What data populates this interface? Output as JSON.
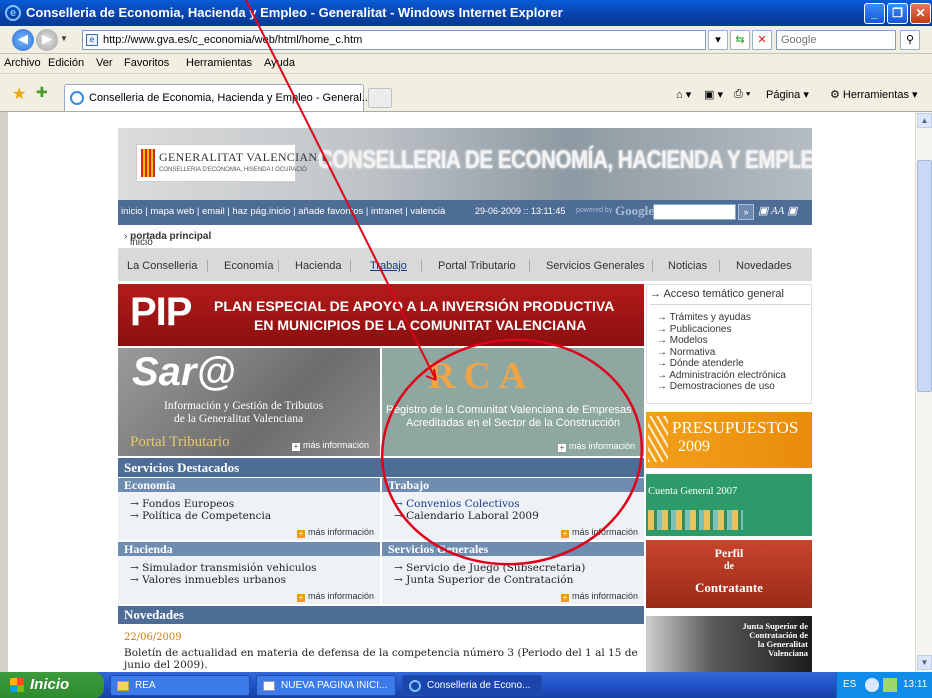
{
  "window": {
    "title": "Conselleria de Economia, Hacienda y Empleo - Generalitat - Windows Internet Explorer",
    "url": "http://www.gva.es/c_economia/web/html/home_c.htm",
    "search_placeholder": "Google"
  },
  "menu": [
    "Archivo",
    "Edición",
    "Ver",
    "Favoritos",
    "Herramientas",
    "Ayuda"
  ],
  "tab": {
    "title": "Conselleria de Economia, Hacienda y Empleo - General..."
  },
  "commands": {
    "pagina": "Página",
    "herramientas": "Herramientas"
  },
  "header": {
    "logo_name": "GENERALITAT VALENCIANA",
    "logo_sub": "CONSELLERIA D'ECONOMIA, HISENDA I OCUPACIÓ",
    "title": "CONSELLERIA DE ECONOMÍA, HACIENDA Y EMPLEO"
  },
  "utility": {
    "links": "inicio | mapa web | email | haz pág.inicio | añade favoritos | intranet | valencià",
    "date": "29-06-2009  ::  13:11:45",
    "powered": "powered by",
    "google": "Google",
    "text_size": "AA"
  },
  "breadcrumb": {
    "home": "inicio",
    "current": "portada principal"
  },
  "nav": [
    "La Conselleria",
    "Economía",
    "Hacienda",
    "Trabajo",
    "Portal Tributario",
    "Servicios Generales",
    "Noticias",
    "Novedades"
  ],
  "pip": {
    "big": "PIP",
    "line1": "PLAN ESPECIAL DE APOYO A LA INVERSIÓN PRODUCTIVA",
    "line2": "EN MUNICIPIOS DE LA COMUNITAT VALENCIANA"
  },
  "sara": {
    "logo": "Sar@",
    "line1": "Información y Gestión de Tributos",
    "line2": "de la Generalitat Valenciana",
    "portal": "Portal Tributario",
    "more": "más información"
  },
  "rca": {
    "logo": "RCA",
    "line1": "Registro de la Comunitat Valenciana de Empresas",
    "line2": "Acreditadas en el Sector de la Construcción",
    "more": "más información"
  },
  "services": {
    "title": "Servicios Destacados",
    "more": "más información",
    "economia": {
      "head": "Economía",
      "items": [
        "→ Fondos Europeos",
        "→ Política de Competencia"
      ]
    },
    "trabajo": {
      "head": "Trabajo",
      "items": [
        "→ Convenios Colectivos",
        "→ Calendario Laboral 2009"
      ]
    },
    "hacienda": {
      "head": "Hacienda",
      "items": [
        "→ Simulador transmisión vehiculos",
        "→ Valores inmuebles urbanos"
      ]
    },
    "generales": {
      "head": "Servicios Generales",
      "items": [
        "→ Servicio de Juego (Subsecretaria)",
        "→ Junta Superior de Contratación"
      ]
    }
  },
  "novedades": {
    "title": "Novedades",
    "date": "22/06/2009",
    "text": "Boletín de actualidad en materia de defensa de la competencia número 3 (Periodo del 1 al 15 de junio del 2009)."
  },
  "acceso": {
    "title": "→ Acceso temático general",
    "items": [
      "→ Trámites y ayudas",
      "→ Publicaciones",
      "→ Modelos",
      "→ Normativa",
      "→ Dónde atenderle",
      "→ Administración electrónica",
      "→ Demostraciones de uso"
    ]
  },
  "banners": {
    "presupuestos_1": "PRESUPUESTOS",
    "presupuestos_2": "2009",
    "cuenta": "Cuenta General 2007",
    "perfil_1": "Perfil",
    "perfil_2": "de",
    "perfil_3": "Contratante",
    "junta_1": "Junta Superior de",
    "junta_2": "Contratación de",
    "junta_3": "la Generalitat",
    "junta_4": "Valenciana"
  },
  "taskbar": {
    "start": "Inicio",
    "tasks": [
      "REA",
      "NUEVA PAGINA INICI...",
      "Conselleria de Econo..."
    ],
    "lang": "ES",
    "clock": "13:11"
  },
  "colors": {
    "site_blue": "#4e6d96",
    "pip_red": "#a11717",
    "annotation_red": "#e0001a",
    "orange": "#ee9a1a"
  }
}
